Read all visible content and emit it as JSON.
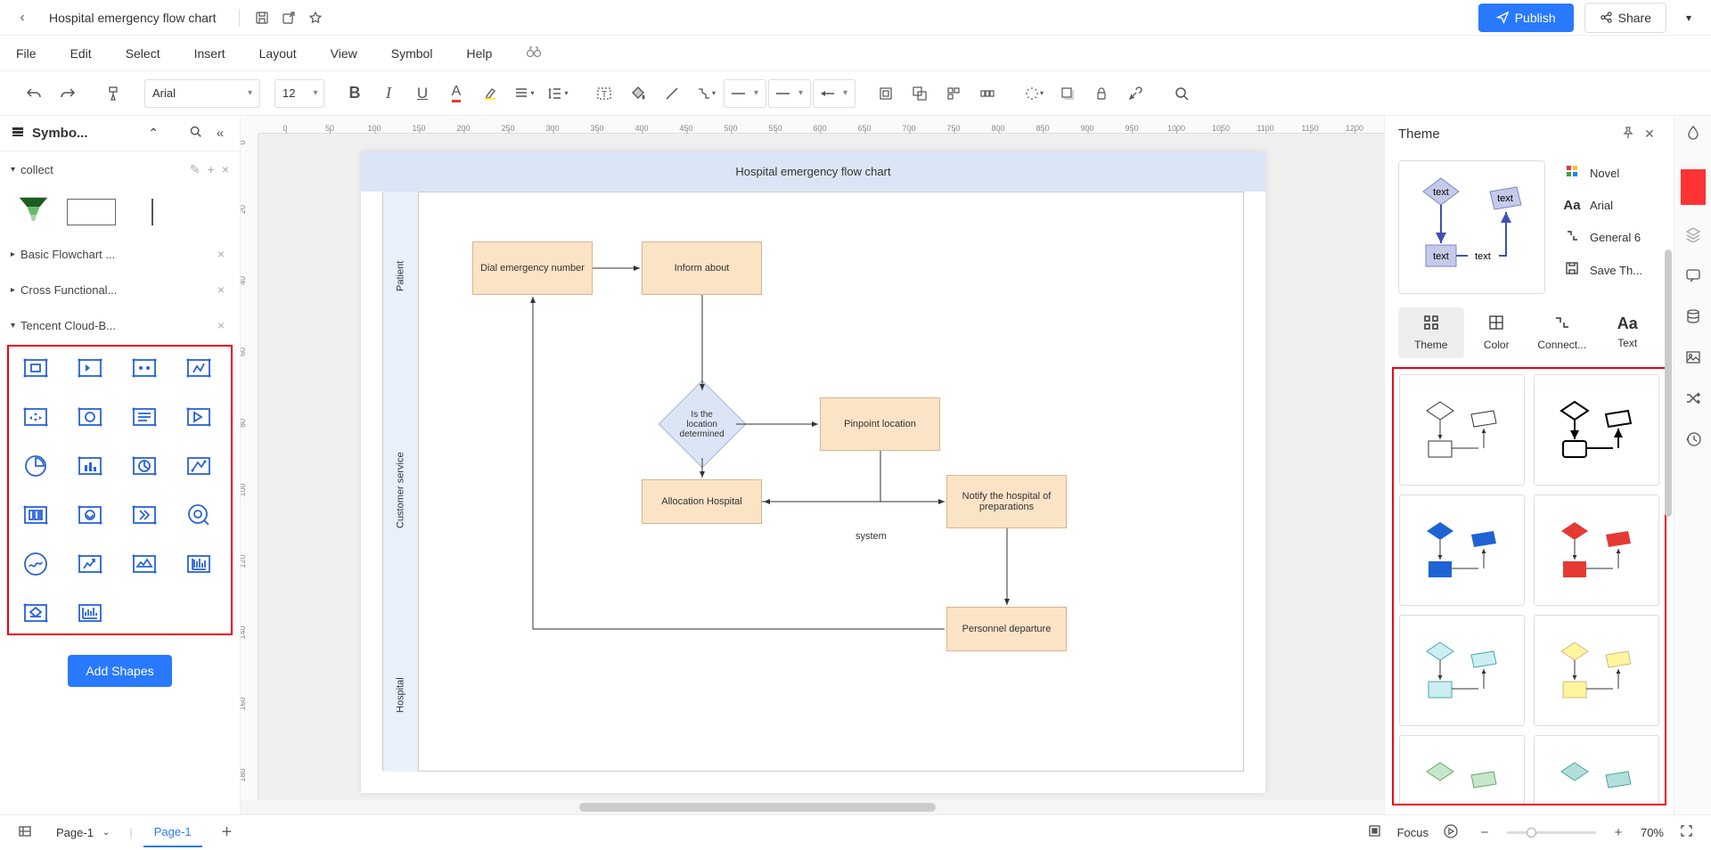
{
  "topbar": {
    "title": "Hospital emergency flow chart",
    "publish": "Publish",
    "share": "Share"
  },
  "menubar": {
    "items": [
      "File",
      "Edit",
      "Select",
      "Insert",
      "Layout",
      "View",
      "Symbol",
      "Help"
    ]
  },
  "toolbar": {
    "font": "Arial",
    "fontsize": "12"
  },
  "left": {
    "title": "Symbo...",
    "sections": {
      "collect": "collect",
      "basic": "Basic Flowchart ...",
      "cross": "Cross Functional...",
      "tencent": "Tencent Cloud-B..."
    },
    "add_shapes": "Add Shapes"
  },
  "canvas": {
    "title": "Hospital emergency flow chart",
    "lanes": {
      "patient": "Patient",
      "cs": "Customer service",
      "hospital": "Hospital"
    },
    "nodes": {
      "dial": "Dial emergency number",
      "inform": "Inform about",
      "is_loc": "Is the location determined",
      "pinpoint": "Pinpoint location",
      "alloc": "Allocation Hospital",
      "notify": "Notify the hospital of preparations",
      "personnel": "Personnel departure",
      "system": "system"
    },
    "ruler_h": [
      "0",
      "50",
      "100",
      "150",
      "200",
      "250",
      "300",
      "350",
      "400",
      "450",
      "500",
      "550",
      "600",
      "650",
      "700",
      "750",
      "800",
      "850",
      "900",
      "950",
      "1000",
      "1050",
      "1100",
      "1150",
      "1200"
    ],
    "ruler_v": [
      "0",
      "20",
      "40",
      "60",
      "80",
      "100",
      "120",
      "140",
      "160",
      "180"
    ]
  },
  "right": {
    "title": "Theme",
    "props": {
      "novel": "Novel",
      "font": "Arial",
      "connect": "General 6",
      "save": "Save Th..."
    },
    "tabs": {
      "theme": "Theme",
      "color": "Color",
      "connect": "Connect...",
      "text": "Text"
    },
    "preview": {
      "t1": "text",
      "t2": "text",
      "t3": "text",
      "t4": "text"
    }
  },
  "bottom": {
    "page_select": "Page-1",
    "page_tab": "Page-1",
    "focus": "Focus",
    "zoom": "70%"
  }
}
